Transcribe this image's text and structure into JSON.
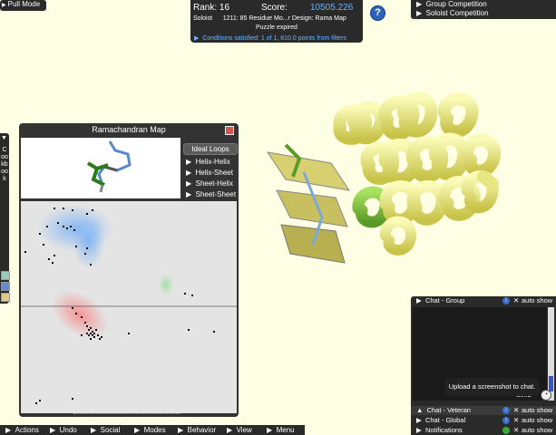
{
  "pull_mode": "Pull Mode",
  "score_panel": {
    "rank_label": "Rank: 16",
    "score_label": "Score:",
    "score_value": "10505.226",
    "player_type": "Soloist",
    "puzzle": "1211: 85 Residue Mo...r Design: Rama Map",
    "status": "Puzzle expired",
    "conditions": "Conditions satisfied: 1 of 1, 810.0 points from filters"
  },
  "help_label": "?",
  "competitions": {
    "items": [
      "Group Competition",
      "Soloist Competition"
    ]
  },
  "cookbook": {
    "label": "Cookbook"
  },
  "rama": {
    "title": "Ramachandran Map",
    "ideal_loops": "Ideal Loops",
    "loops": [
      "Helix-Helix",
      "Helix-Sheet",
      "Sheet-Helix",
      "Sheet-Sheet"
    ]
  },
  "chat": {
    "group": "Chat - Group",
    "veteran": "Chat - Veteran",
    "global": "Chat - Global",
    "notifications": "Notifications",
    "auto_show": "auto show",
    "send": "Send",
    "tooltip": "Upload a screenshot to chat."
  },
  "bottom_menu": [
    "Actions",
    "Undo",
    "Social",
    "Modes",
    "Behavior",
    "View",
    "Menu"
  ],
  "colors": {
    "background": "#fefee4",
    "panel": "#2a2a2a",
    "accent_blue": "#6cb5ff",
    "helix_yellow": "#e8e680",
    "sheet_green": "#7fbf3a"
  }
}
